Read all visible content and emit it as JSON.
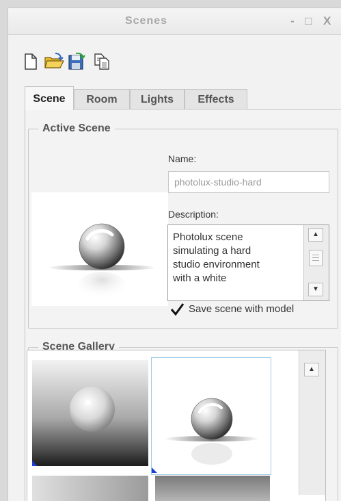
{
  "window": {
    "title": "Scenes",
    "minimize_label": "-",
    "maximize_label": "□",
    "close_label": "X"
  },
  "toolbar": {
    "icons": [
      "new-icon",
      "open-icon",
      "save-icon",
      "copy-icon"
    ]
  },
  "tabs": [
    {
      "label": "Scene",
      "active": true
    },
    {
      "label": "Room",
      "active": false
    },
    {
      "label": "Lights",
      "active": false
    },
    {
      "label": "Effects",
      "active": false
    }
  ],
  "active_scene": {
    "group_label": "Active Scene",
    "name_label": "Name:",
    "name_value": "photolux-studio-hard",
    "description_label": "Description:",
    "description_lines": [
      "Photolux scene",
      "simulating a hard",
      "studio environment",
      "with a white"
    ],
    "save_checkbox_label": "Save scene with model",
    "save_checked": true
  },
  "gallery": {
    "group_label": "Scene Gallery"
  },
  "colors": {
    "accent_corner": "#1d3ed0",
    "panel_bg": "#f2f2f2"
  }
}
